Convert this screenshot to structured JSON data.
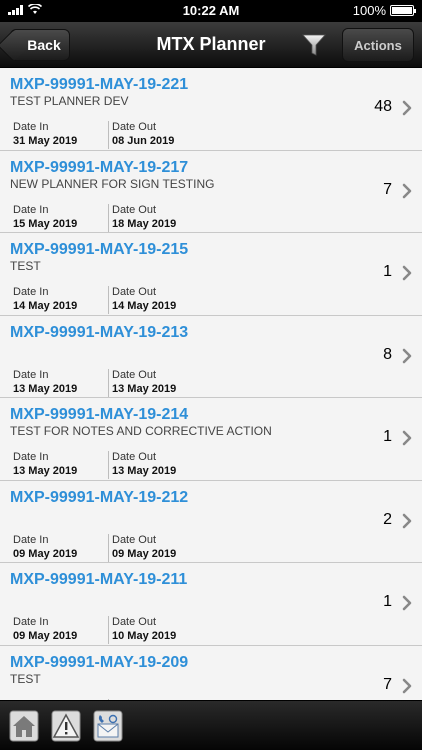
{
  "status": {
    "time": "10:22 AM",
    "battery": "100%"
  },
  "nav": {
    "back_label": "Back",
    "title": "MTX Planner",
    "actions_label": "Actions"
  },
  "labels": {
    "date_in": "Date In",
    "date_out": "Date Out"
  },
  "items": [
    {
      "id": "MXP-99991-MAY-19-221",
      "desc": "TEST PLANNER DEV",
      "count": "48",
      "date_in": "31 May 2019",
      "date_out": "08 Jun 2019"
    },
    {
      "id": "MXP-99991-MAY-19-217",
      "desc": "NEW PLANNER FOR SIGN TESTING",
      "count": "7",
      "date_in": "15 May 2019",
      "date_out": "18 May 2019"
    },
    {
      "id": "MXP-99991-MAY-19-215",
      "desc": "TEST",
      "count": "1",
      "date_in": "14 May 2019",
      "date_out": "14 May 2019"
    },
    {
      "id": "MXP-99991-MAY-19-213",
      "desc": "",
      "count": "8",
      "date_in": "13 May 2019",
      "date_out": "13 May 2019"
    },
    {
      "id": "MXP-99991-MAY-19-214",
      "desc": "TEST FOR NOTES AND CORRECTIVE ACTION",
      "count": "1",
      "date_in": "13 May 2019",
      "date_out": "13 May 2019"
    },
    {
      "id": "MXP-99991-MAY-19-212",
      "desc": "",
      "count": "2",
      "date_in": "09 May 2019",
      "date_out": "09 May 2019"
    },
    {
      "id": "MXP-99991-MAY-19-211",
      "desc": "",
      "count": "1",
      "date_in": "09 May 2019",
      "date_out": "10 May 2019"
    },
    {
      "id": "MXP-99991-MAY-19-209",
      "desc": "TEST",
      "count": "7",
      "date_in": "",
      "date_out": ""
    }
  ],
  "icons": {
    "filter": "filter-icon",
    "chevron": "chevron-right-icon",
    "home": "home-icon",
    "alert": "warning-icon",
    "contact": "contact-icon"
  },
  "colors": {
    "title_blue": "#2e8fd8",
    "nav_dark": "#1c1c1c"
  }
}
